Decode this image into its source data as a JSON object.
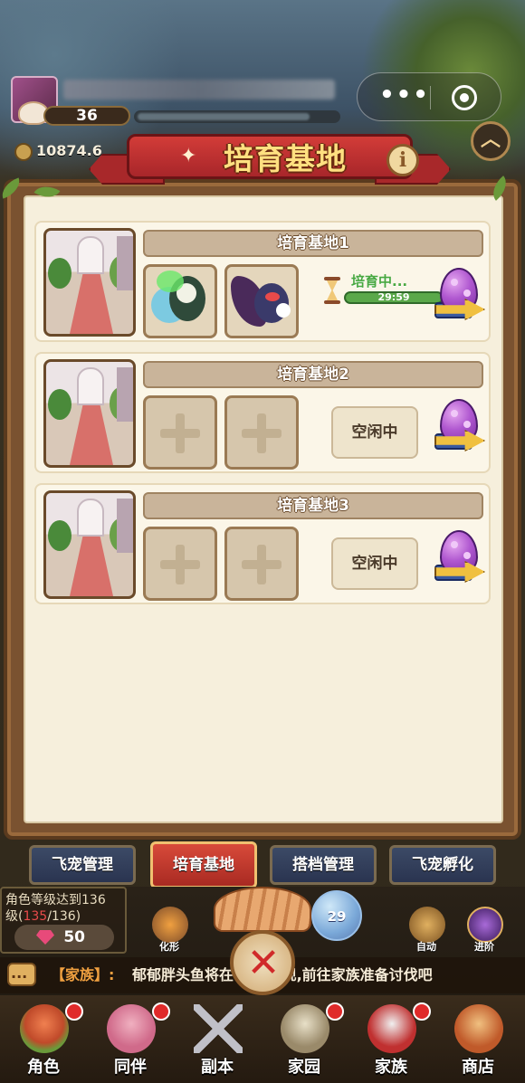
{
  "hud": {
    "level": "36",
    "coins": "10874.6",
    "capsule_dots": "•••"
  },
  "panel": {
    "title": "培育基地",
    "info_symbol": "i"
  },
  "bases": [
    {
      "name": "培育基地1",
      "state": "breeding",
      "status_label": "培育中...",
      "timer": "29:59",
      "progress": 1.0
    },
    {
      "name": "培育基地2",
      "state": "idle",
      "status_label": "空闲中"
    },
    {
      "name": "培育基地3",
      "state": "idle",
      "status_label": "空闲中"
    }
  ],
  "tabs": [
    {
      "label": "飞宠管理",
      "active": false
    },
    {
      "label": "培育基地",
      "active": true
    },
    {
      "label": "搭档管理",
      "active": false
    },
    {
      "label": "飞宠孵化",
      "active": false
    }
  ],
  "bottom": {
    "quest_line1": "角色等级达到136",
    "quest_prefix": "级(",
    "quest_current": "135",
    "quest_suffix": "/136)",
    "gems": "50",
    "bubble_count": "29",
    "icon_transform": "化形",
    "icon_auto": "自动",
    "icon_advance": "进阶",
    "ticker_tag": "【家族】:",
    "ticker_text": "郁郁胖头鱼将在  钟后出现,前往家族准备讨伐吧"
  },
  "nav": [
    {
      "label": "角色",
      "dot": true
    },
    {
      "label": "同伴",
      "dot": true
    },
    {
      "label": "副本",
      "dot": false
    },
    {
      "label": "家园",
      "dot": true
    },
    {
      "label": "家族",
      "dot": true
    },
    {
      "label": "商店",
      "dot": false
    }
  ],
  "colors": {
    "panel_bg": "#f6efdc",
    "frame": "#7a5230",
    "ribbon": "#c63232",
    "tab_active": "#c83a2e",
    "tab_inactive": "#334060",
    "breeding_green": "#5aa84a"
  }
}
